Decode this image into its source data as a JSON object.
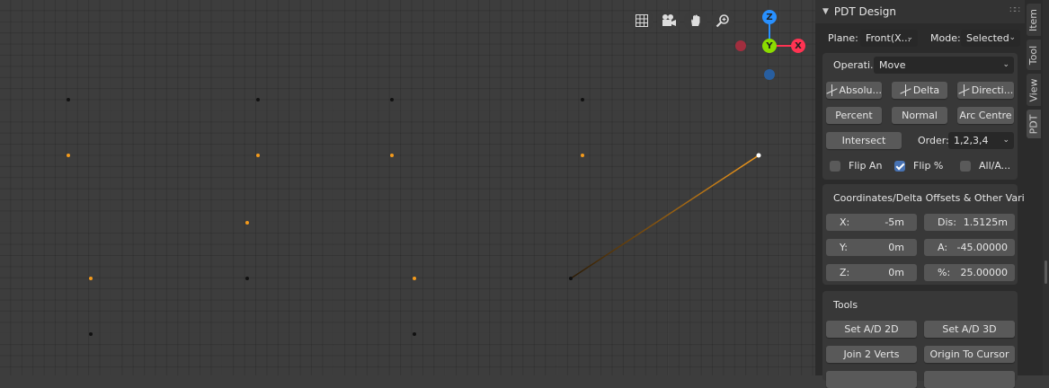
{
  "colors": {
    "selected": "#f39a1c",
    "vertex": "#111111",
    "active_vertex": "#ffffff",
    "x_axis": "#ff3352",
    "y_axis": "#8bdc00",
    "z_axis": "#2890ff"
  },
  "viewport_tools": [
    "grid-toggle-icon",
    "camera-icon",
    "hand-pan-icon",
    "zoom-icon"
  ],
  "gizmo": {
    "x": "X",
    "y": "Y",
    "z": "Z"
  },
  "panel": {
    "title": "PDT Design",
    "plane_label": "Plane:",
    "plane_value": "Front(X...",
    "mode_label": "Mode:",
    "mode_value": "Selected",
    "operation_label": "Operati...",
    "operation_value": "Move",
    "btn_absolute": "Absolu...",
    "btn_delta": "Delta",
    "btn_direction": "Directi...",
    "btn_percent": "Percent",
    "btn_normal": "Normal",
    "btn_arc_centre": "Arc Centre",
    "btn_intersect": "Intersect",
    "order_label": "Order:",
    "order_value": "1,2,3,4",
    "flip_angle": "Flip An",
    "flip_percent": "Flip %",
    "all_active": "All/A...",
    "coords_title": "Coordinates/Delta Offsets & Other Vari...",
    "x_label": "X:",
    "x_value": "-5m",
    "dis_label": "Dis:",
    "dis_value": "1.5125m",
    "y_label": "Y:",
    "y_value": "0m",
    "a_label": "A:",
    "a_value": "-45.00000",
    "z_label": "Z:",
    "z_value": "0m",
    "pct_label": "%:",
    "pct_value": "25.00000",
    "tools_title": "Tools",
    "set_ad_2d": "Set A/D 2D",
    "set_ad_3d": "Set A/D 3D",
    "join_2_verts": "Join 2 Verts",
    "origin_to_cursor": "Origin To Cursor"
  },
  "checkboxes": {
    "flip_angle": false,
    "flip_percent": true,
    "all_active": false
  },
  "tabs": [
    "Item",
    "Tool",
    "View",
    "PDT"
  ],
  "active_tab": "PDT"
}
